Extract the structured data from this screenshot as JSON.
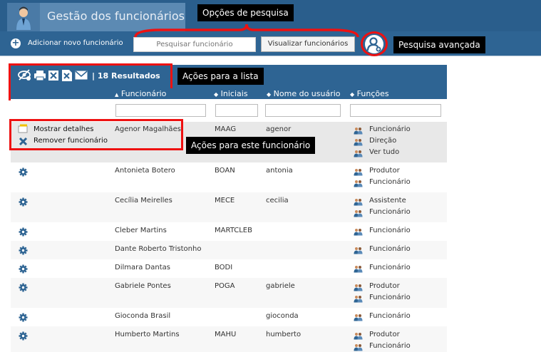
{
  "header": {
    "title": "Gestão dos funcionários"
  },
  "toolbar": {
    "add_label": "Adicionar novo funcionário",
    "search_placeholder": "Pesquisar funcionário",
    "view_button": "Visualizar funcionários"
  },
  "callouts": {
    "search_options": "Opções de pesquisa",
    "advanced_search": "Pesquisa avançada",
    "list_actions": "Ações para a lista",
    "employee_actions": "Ações para este funcionário"
  },
  "list": {
    "results_label": "| 18 Resultados"
  },
  "columns": [
    {
      "label": "Funcionário",
      "sort": "▲"
    },
    {
      "label": "Iniciais",
      "sort": "◆"
    },
    {
      "label": "Nome do usuário",
      "sort": "◆"
    },
    {
      "label": "Funções",
      "sort": "◆"
    }
  ],
  "row_actions": {
    "show_details": "Mostrar detalhes",
    "remove": "Remover funcionário"
  },
  "rows": [
    {
      "name": "Agenor Magalhães",
      "initials": "MAAG",
      "username": "agenor",
      "roles": [
        "Funcionário",
        "Direção",
        "Ver tudo"
      ]
    },
    {
      "name": "Antonieta Botero",
      "initials": "BOAN",
      "username": "antonia",
      "roles": [
        "Produtor",
        "Funcionário"
      ]
    },
    {
      "name": "Cecília Meirelles",
      "initials": "MECE",
      "username": "cecilia",
      "roles": [
        "Assistente",
        "Funcionário"
      ]
    },
    {
      "name": "Cleber Martins",
      "initials": "MARTCLEB",
      "username": "",
      "roles": [
        "Funcionário"
      ]
    },
    {
      "name": "Dante Roberto Tristonho",
      "initials": "",
      "username": "",
      "roles": [
        "Funcionário"
      ]
    },
    {
      "name": "Dilmara Dantas",
      "initials": "BODI",
      "username": "",
      "roles": [
        "Funcionário"
      ]
    },
    {
      "name": "Gabriele Pontes",
      "initials": "POGA",
      "username": "gabriele",
      "roles": [
        "Produtor",
        "Funcionário"
      ]
    },
    {
      "name": "Gioconda Brasil",
      "initials": "",
      "username": "gioconda",
      "roles": [
        "Funcionário"
      ]
    },
    {
      "name": "Humberto Martins",
      "initials": "MAHU",
      "username": "humberto",
      "roles": [
        "Produtor",
        "Funcionário"
      ]
    }
  ],
  "colors": {
    "header": "#2a5e8c",
    "toolbar": "#2e6493",
    "highlight": "#ee1111",
    "callout": "#000000"
  }
}
